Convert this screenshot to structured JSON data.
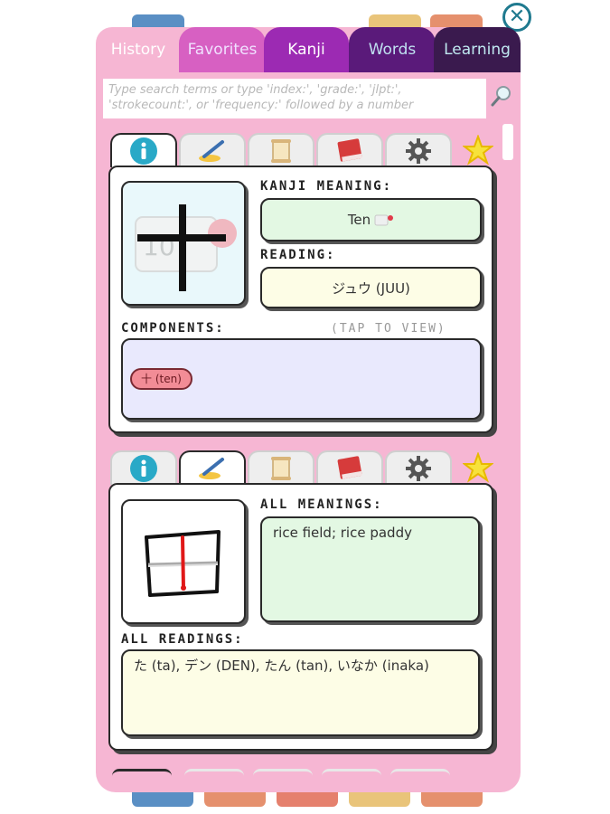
{
  "window": {
    "close_glyph": "✕"
  },
  "top_tabs": [
    {
      "label": "History",
      "color": "#f6b6d3"
    },
    {
      "label": "Favorites",
      "color": "#d760c2"
    },
    {
      "label": "Kanji",
      "color": "#9c2ab3"
    },
    {
      "label": "Words",
      "color": "#5a1a7a"
    },
    {
      "label": "Learning",
      "color": "#3a1a4e"
    }
  ],
  "search": {
    "placeholder": "Type search terms or type 'index:', 'grade:', 'jlpt:', 'strokecount:', or 'frequency:' followed by a number",
    "icon": "magnifier-icon"
  },
  "card1": {
    "tabs": [
      "info-icon",
      "brush-icon",
      "scroll-icon",
      "book-icon",
      "gear-icon"
    ],
    "active_tab": 0,
    "kanji_char": "十",
    "kanji_meaning_label": "Kanji Meaning:",
    "kanji_meaning_value": "Ten",
    "reading_label": "Reading:",
    "reading_value": "ジュウ (JUU)",
    "components_label": "Components:",
    "components_hint": "(Tap to view)",
    "components": [
      "十 (ten)"
    ]
  },
  "card2": {
    "tabs": [
      "info-icon",
      "brush-icon",
      "scroll-icon",
      "book-icon",
      "gear-icon"
    ],
    "active_tab": 1,
    "all_meanings_label": "All Meanings:",
    "all_meanings_value": "rice field; rice paddy",
    "all_readings_label": "All Readings:",
    "all_readings_value": "た (ta), デン (DEN), たん (tan), いなか (inaka)"
  },
  "colors": {
    "accent_teal": "#29a9c7",
    "meaning_bg": "#e3f8e3",
    "reading_bg": "#fdfde6",
    "components_bg": "#e9e9fd",
    "kanji_box_bg": "#e9f8fb"
  }
}
